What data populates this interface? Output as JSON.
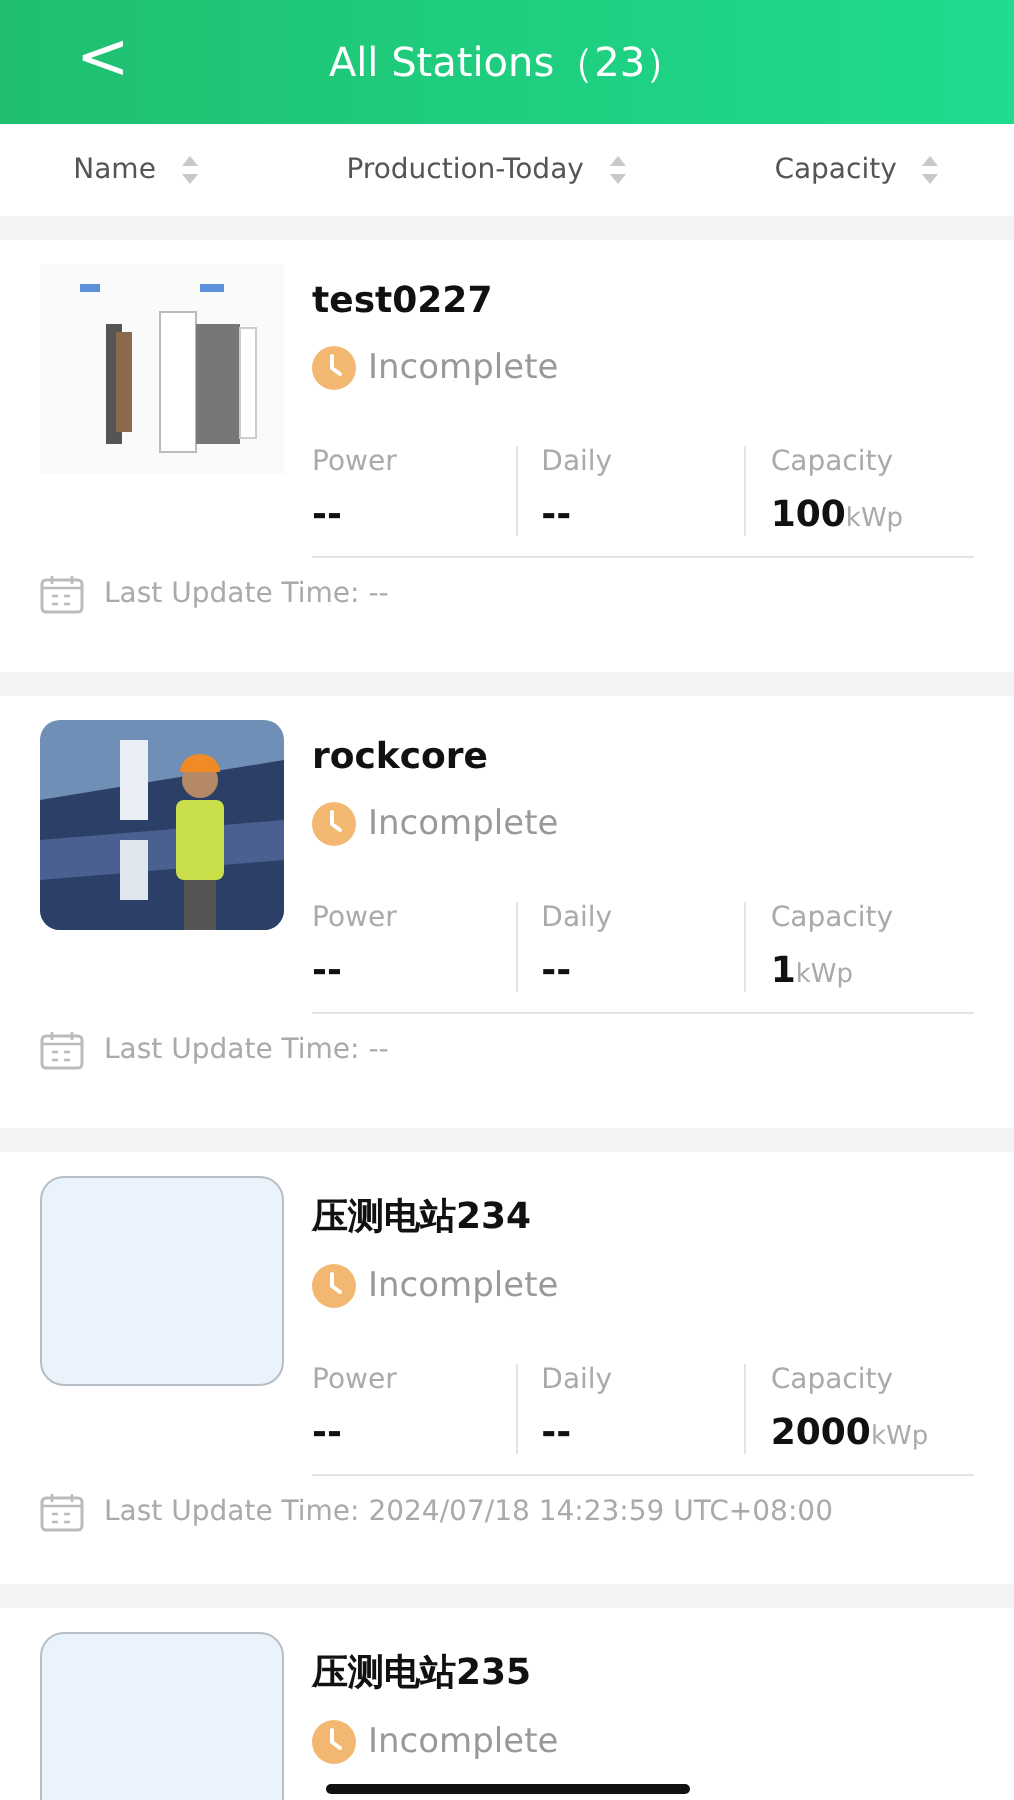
{
  "header": {
    "back_icon": "<",
    "title": "All Stations（23）"
  },
  "sort_bar": [
    {
      "label": "Name"
    },
    {
      "label": "Production-Today"
    },
    {
      "label": "Capacity"
    }
  ],
  "stations": [
    {
      "name": "test0227",
      "thumbnail": {
        "kind": "picture"
      },
      "status": "Incomplete",
      "stats": [
        {
          "label": "Power",
          "value": "--"
        },
        {
          "label": "Daily",
          "value": "--"
        },
        {
          "label": "Capacity",
          "value": "100",
          "unit": "kWp"
        }
      ],
      "last_update": "Last Update Time: --"
    },
    {
      "name": "rockcore",
      "thumbnail": {
        "kind": "picture"
      },
      "status": "Incomplete",
      "stats": [
        {
          "label": "Power",
          "value": "--"
        },
        {
          "label": "Daily",
          "value": "--"
        },
        {
          "label": "Capacity",
          "value": "1",
          "unit": "kWp"
        }
      ],
      "last_update": "Last Update Time: --"
    },
    {
      "name": "压测电站234",
      "thumbnail": {
        "kind": "blank"
      },
      "status": "Incomplete",
      "stats": [
        {
          "label": "Power",
          "value": "--"
        },
        {
          "label": "Daily",
          "value": "--"
        },
        {
          "label": "Capacity",
          "value": "2000",
          "unit": "kWp"
        }
      ],
      "last_update": "Last Update Time: 2024/07/18 14:23:59 UTC+08:00"
    },
    {
      "name": "压测电站235",
      "thumbnail": {
        "kind": "blank"
      },
      "status": "Incomplete"
    }
  ]
}
